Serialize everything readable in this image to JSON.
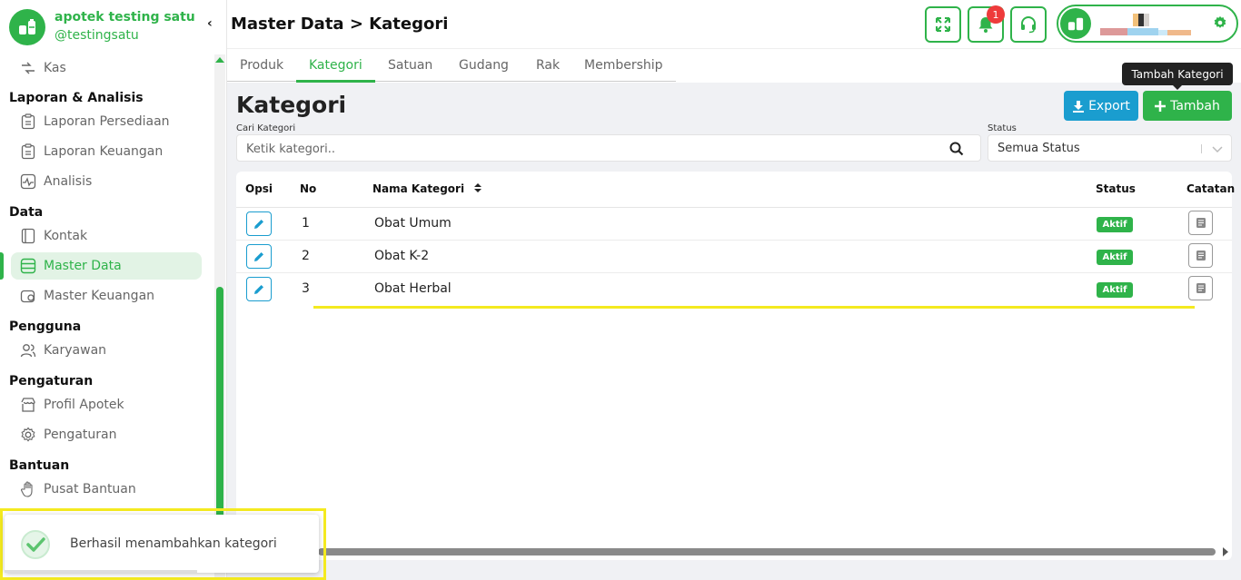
{
  "brand": {
    "name": "apotek testing satu",
    "handle": "@testingsatu"
  },
  "sidebar": {
    "partial_item": "Kas",
    "sections": [
      {
        "title": "Laporan & Analisis",
        "items": [
          "Laporan Persediaan",
          "Laporan Keuangan",
          "Analisis"
        ]
      },
      {
        "title": "Data",
        "items": [
          "Kontak",
          "Master Data",
          "Master Keuangan"
        ]
      },
      {
        "title": "Pengguna",
        "items": [
          "Karyawan"
        ]
      },
      {
        "title": "Pengaturan",
        "items": [
          "Profil Apotek",
          "Pengaturan"
        ]
      },
      {
        "title": "Bantuan",
        "items": [
          "Pusat Bantuan"
        ]
      }
    ],
    "active_item": "Master Data"
  },
  "header": {
    "breadcrumb": "Master Data > Kategori",
    "notification_count": "1"
  },
  "tabs": [
    "Produk",
    "Kategori",
    "Satuan",
    "Gudang",
    "Rak",
    "Membership"
  ],
  "active_tab": "Kategori",
  "page": {
    "title": "Kategori",
    "export_label": "Export",
    "add_label": "Tambah",
    "add_tooltip": "Tambah Kategori"
  },
  "filters": {
    "search_label": "Cari Kategori",
    "search_placeholder": "Ketik kategori..",
    "status_label": "Status",
    "status_value": "Semua Status"
  },
  "table": {
    "headers": {
      "opsi": "Opsi",
      "no": "No",
      "nama": "Nama Kategori",
      "status": "Status",
      "catatan": "Catatan"
    },
    "rows": [
      {
        "no": "1",
        "name": "Obat Umum",
        "status": "Aktif"
      },
      {
        "no": "2",
        "name": "Obat K-2",
        "status": "Aktif"
      },
      {
        "no": "3",
        "name": "Obat Herbal",
        "status": "Aktif"
      }
    ]
  },
  "toast": {
    "message": "Berhasil menambahkan kategori"
  },
  "colors": {
    "brand_green": "#2fb34a",
    "export_blue": "#1a9dcf",
    "badge_red": "#ee3b3b",
    "annotation_yellow": "#f4ea20"
  }
}
